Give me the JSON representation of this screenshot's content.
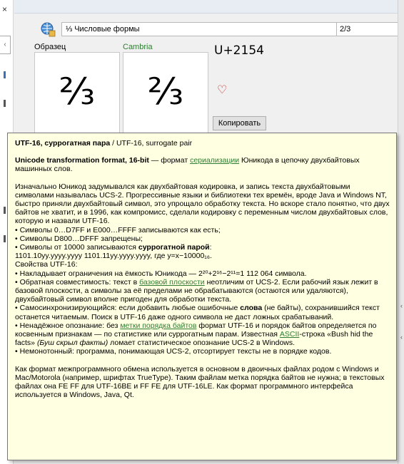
{
  "left_strip": {
    "close_glyph": "×",
    "arrow_glyph": "‹"
  },
  "toolbar": {
    "block_select_value": "⅓ Числовые формы",
    "search_value": "2/3"
  },
  "preview": {
    "sample_label": "Образец",
    "font_label": "Cambria",
    "glyph": "⅔",
    "codepoint": "U+2154",
    "favorite_glyph": "♡",
    "copy_button": "Копировать"
  },
  "tooltip": {
    "title_bold": "UTF-16, суррогатная пара",
    "title_rest": " / UTF-16, surrogate pair",
    "def_bold": "Unicode transformation format, 16-bit",
    "def_mid": " — формат ",
    "def_link": "сериализации",
    "def_end": " Юникода в цепочку двухбайтовых машинных слов.",
    "p1": "Изначально Юникод задумывался как двухбайтовая кодировка, и запись текста двухбайтовыми символами называлась UCS-2. Прогрессивные языки и библиотеки тех времён, вроде Java и Windows NT, быстро приняли двухбайтовый символ, это упрощало обработку текста. Но вскоре стало понятно, что двух байтов не хватит, и в 1996, как компромисс, сделали кодировку с переменным числом двухбайтовых слов, которую и назвали UTF-16.",
    "b1": "• Символы 0…D7FF и E000…FFFF записываются как есть;",
    "b2": "• Символы D800…DFFF запрещены;",
    "b3_start": "• Символы от 10000 записываются ",
    "b3_bold": "суррогатной парой",
    "b3_end": ":",
    "code": "1101.10yy.yyyy.yyyy 1101.11yy.yyyy.yyyy, где y=x−10000₁₆.",
    "props_title": "Свойства UTF-16:",
    "pr1": "• Накладывает ограничения на ёмкость Юникода — 2²⁰+2¹⁶−2¹¹=1 112 064 символа.",
    "pr2_start": "• Обратная совместимость: текст в ",
    "pr2_link": "базовой плоскости",
    "pr2_end": " неотличим от UCS-2. Если рабочий язык лежит в базовой плоскости, а символы за её пределами не обрабатываются (остаются или удаляются), двухбайтовый символ вполне пригоден для обработки текста.",
    "pr3_start": "• Самосинхронизирующийся: если добавить любые ошибочные ",
    "pr3_bold": "слова",
    "pr3_end": " (не байты), сохранившийся текст останется читаемым. Поиск в UTF-16 даже одного символа не даст ложных срабатываний.",
    "pr4_start": "• Ненадёжное опознание: без ",
    "pr4_link": "метки порядка байтов",
    "pr4_mid": " формат UTF-16 и порядок байтов определяется по косвенным признакам — по статистике или суррогатным парам. Известная ",
    "pr4_link2": "ASCII",
    "pr4_mid2": "-строка «Bush hid the facts» ",
    "pr4_italic": "(Буш скрыл факты)",
    "pr4_end": " ломает статистическое опознание UCS-2 в Windows.",
    "pr5": "• Немонотонный: программа, понимающая UCS-2, отсортирует тексты не в порядке кодов.",
    "final": "Как формат межпрограммного обмена используется в основном в двоичных файлах родом с Windows и Mac/Motorola (например, шрифтах TrueType). Таким файлам метка порядка байтов не нужна; в текстовых файлах она FE FF для UTF-16BE и FF FE для UTF-16LE. Как формат программного интерфейса используется в Windows, Java, Qt."
  },
  "colors": {
    "link": "#2e7d32",
    "tooltip_bg": "#ffffe1",
    "heart": "#c62828"
  }
}
